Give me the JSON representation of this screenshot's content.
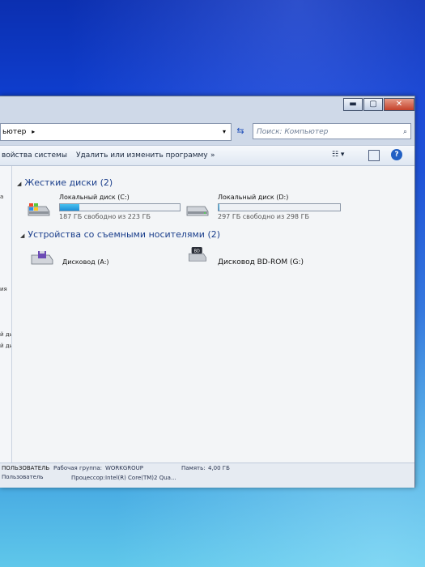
{
  "window": {
    "caption_buttons": {
      "minimize": "▬",
      "maximize": "▢",
      "close": "✕"
    }
  },
  "address": {
    "path": "ьютер",
    "arrow": "▸",
    "dropdown": "▾",
    "refresh": "⇆",
    "search_placeholder": "Поиск: Компьютер",
    "search_icon": "⌕"
  },
  "toolbar": {
    "properties_label": "войства системы",
    "uninstall_label": "Удалить или изменить программу",
    "more_label": "»",
    "view_label": "☷ ▾",
    "help_label": "?"
  },
  "nav_pane": {
    "items": [
      "а",
      "ия",
      "й диск (C",
      "й диск (D"
    ]
  },
  "groups": {
    "hard_disks": {
      "title": "Жесткие диски (2)",
      "toggle": "◢"
    },
    "removable": {
      "title": "Устройства со съемными носителями (2)",
      "toggle": "◢"
    }
  },
  "drives": {
    "c": {
      "name": "Локальный диск (C:)",
      "free_text": "187 ГБ свободно из 223 ГБ",
      "used_fraction": 0.16
    },
    "d": {
      "name": "Локальный диск (D:)",
      "free_text": "297 ГБ свободно из 298 ГБ",
      "used_fraction": 0.003
    },
    "a": {
      "name": "Дисковод (A:)"
    },
    "g": {
      "name": "Дисковод BD-ROM (G:)",
      "icon_text": "BD"
    }
  },
  "details": {
    "computer_name": "ПОЛЬЗОВАТЕЛЬ",
    "workgroup_label": "Рабочая группа:",
    "workgroup_value": "WORKGROUP",
    "memory_label": "Память:",
    "memory_value": "4,00 ГБ",
    "user_label": "Пользователь",
    "processor_label": "Процессор:",
    "processor_value": "Intel(R) Core(TM)2 Qua..."
  },
  "colors": {
    "accent": "#1b3f8c",
    "progress": "#1d8fd8"
  }
}
